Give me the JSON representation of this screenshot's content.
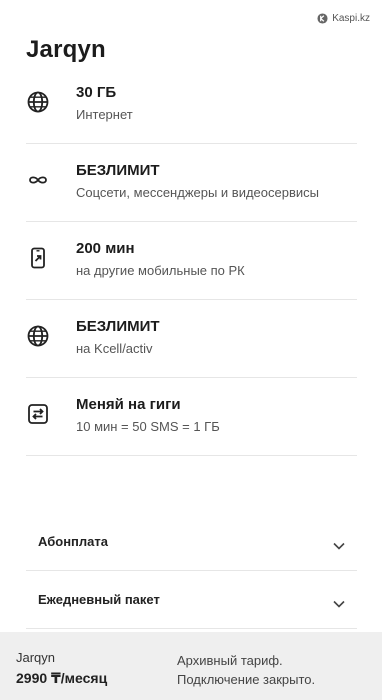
{
  "watermark": {
    "text": "Kaspi.kz"
  },
  "tariff": {
    "title": "Jarqyn"
  },
  "features": [
    {
      "icon": "globe-icon",
      "main": "30 ГБ",
      "sub": "Интернет"
    },
    {
      "icon": "infinity-icon",
      "main": "БЕЗЛИМИТ",
      "sub": "Соцсети, мессенджеры и видеосервисы"
    },
    {
      "icon": "phone-arrow-icon",
      "main": "200 мин",
      "sub": "на другие мобильные по РК"
    },
    {
      "icon": "globe-icon",
      "main": "БЕЗЛИМИТ",
      "sub": "на Kcell/activ"
    },
    {
      "icon": "swap-icon",
      "main": "Меняй на гиги",
      "sub": "10 мин = 50 SMS = 1 ГБ"
    }
  ],
  "accordion": [
    {
      "label": "Абонплата"
    },
    {
      "label": "Ежедневный пакет"
    }
  ],
  "footer": {
    "name": "Jarqyn",
    "price": "2990 ₸/месяц",
    "status_line1": "Архивный тариф.",
    "status_line2": "Подключение закрыто."
  }
}
